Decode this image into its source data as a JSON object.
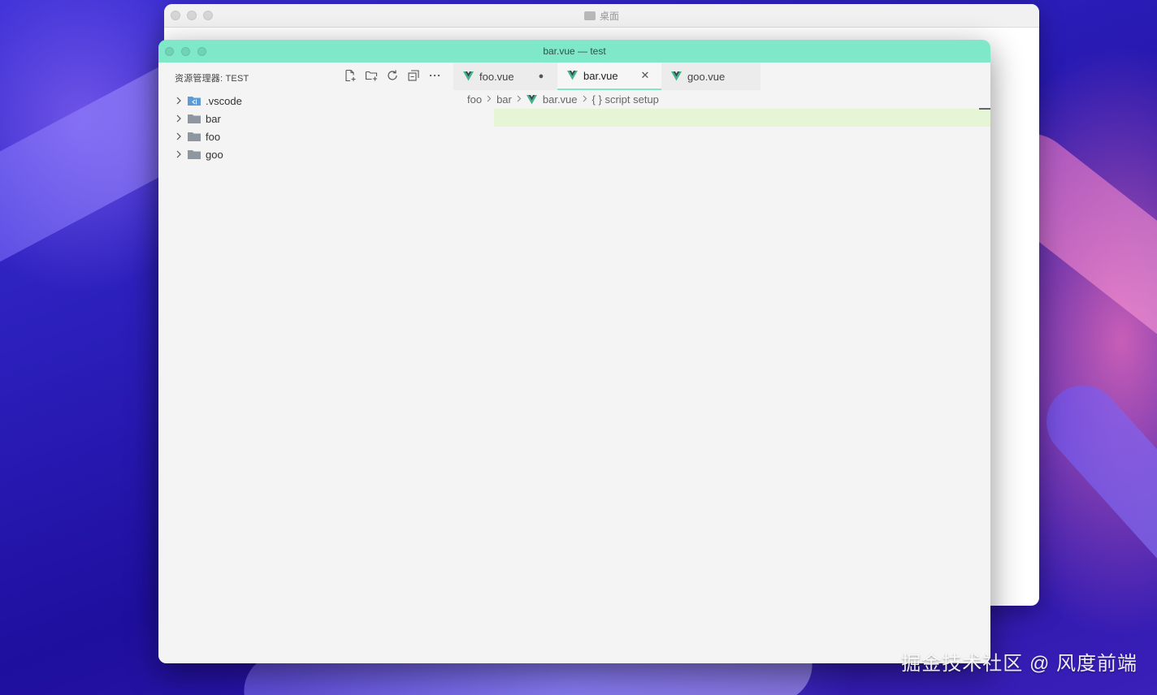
{
  "finder": {
    "title": "桌面"
  },
  "vscode": {
    "title": "bar.vue — test",
    "accent_color": "#7ee8c8",
    "sidebar": {
      "header": "资源管理器: TEST",
      "actions": [
        "new-file-icon",
        "new-folder-icon",
        "refresh-icon",
        "collapse-all-icon",
        "more-icon"
      ],
      "items": [
        {
          "label": ".vscode",
          "icon": "vscode-folder-icon"
        },
        {
          "label": "bar",
          "icon": "folder-icon"
        },
        {
          "label": "foo",
          "icon": "folder-icon"
        },
        {
          "label": "goo",
          "icon": "folder-icon"
        }
      ]
    },
    "tabs": [
      {
        "label": "foo.vue",
        "state": "●",
        "active": false
      },
      {
        "label": "bar.vue",
        "state": "✕",
        "active": true
      },
      {
        "label": "goo.vue",
        "state": "",
        "active": false
      }
    ],
    "breadcrumb": {
      "seg1": "foo",
      "seg2": "bar",
      "seg3": "bar.vue",
      "seg4": "{ } script setup"
    }
  },
  "watermark": "掘金技术社区 @ 风度前端"
}
